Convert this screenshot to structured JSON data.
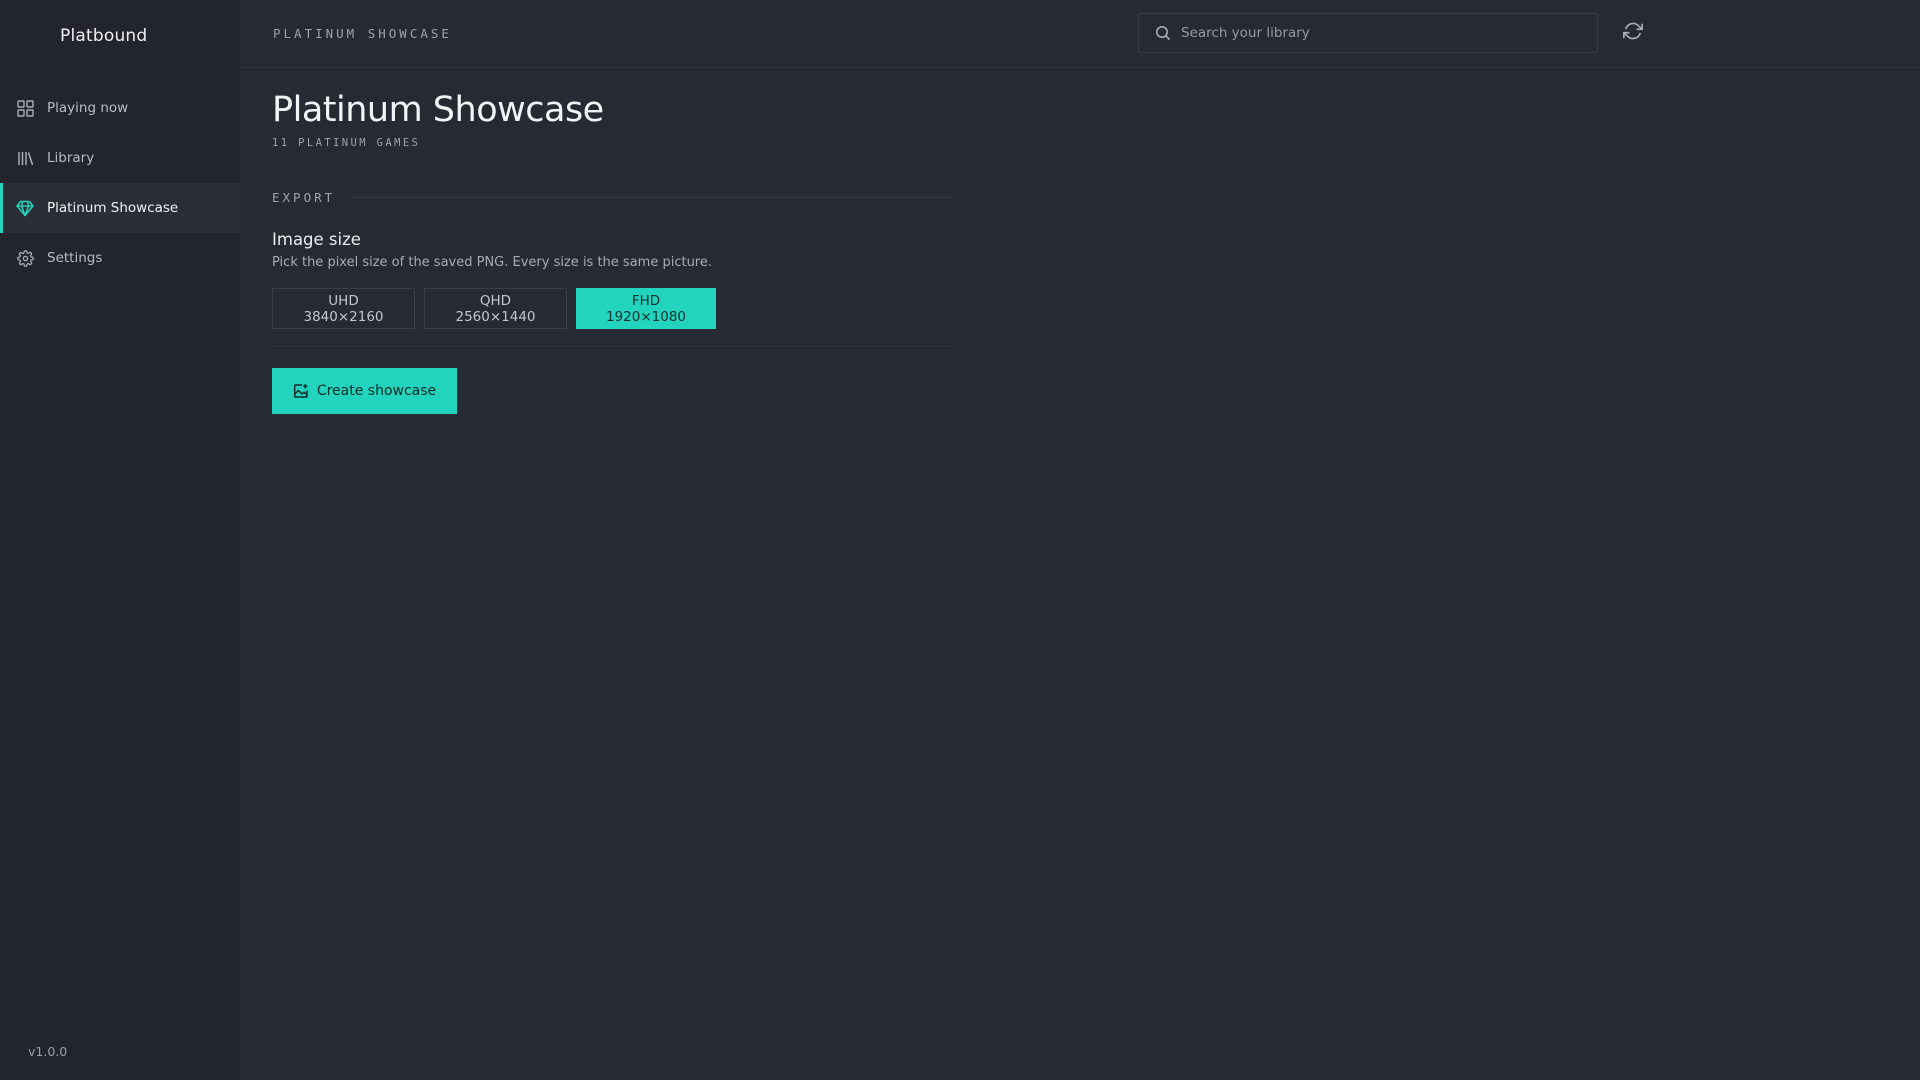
{
  "app": {
    "name": "Platbound",
    "version": "v1.0.0"
  },
  "sidebar": {
    "items": [
      {
        "label": "Playing now",
        "icon": "grid-icon",
        "active": false
      },
      {
        "label": "Library",
        "icon": "library-icon",
        "active": false
      },
      {
        "label": "Platinum Showcase",
        "icon": "diamond-icon",
        "active": true
      },
      {
        "label": "Settings",
        "icon": "gear-icon",
        "active": false
      }
    ]
  },
  "topbar": {
    "breadcrumb": "PLATINUM SHOWCASE",
    "search": {
      "placeholder": "Search your library",
      "value": ""
    },
    "refresh_icon": "refresh-icon"
  },
  "main": {
    "title": "Platinum Showcase",
    "subtitle": "11 PLATINUM GAMES",
    "section": "EXPORT",
    "image_size": {
      "label": "Image size",
      "help": "Pick the pixel size of the saved PNG. Every size is the same picture.",
      "options": [
        {
          "label": "UHD 3840×2160",
          "selected": false
        },
        {
          "label": "QHD 2560×1440",
          "selected": false
        },
        {
          "label": "FHD 1920×1080",
          "selected": true
        }
      ]
    },
    "create_button": {
      "label": "Create showcase",
      "icon": "image-plus-icon"
    }
  },
  "colors": {
    "accent": "#22d3bd",
    "background": "#262a32",
    "sidebar": "#22252c"
  }
}
